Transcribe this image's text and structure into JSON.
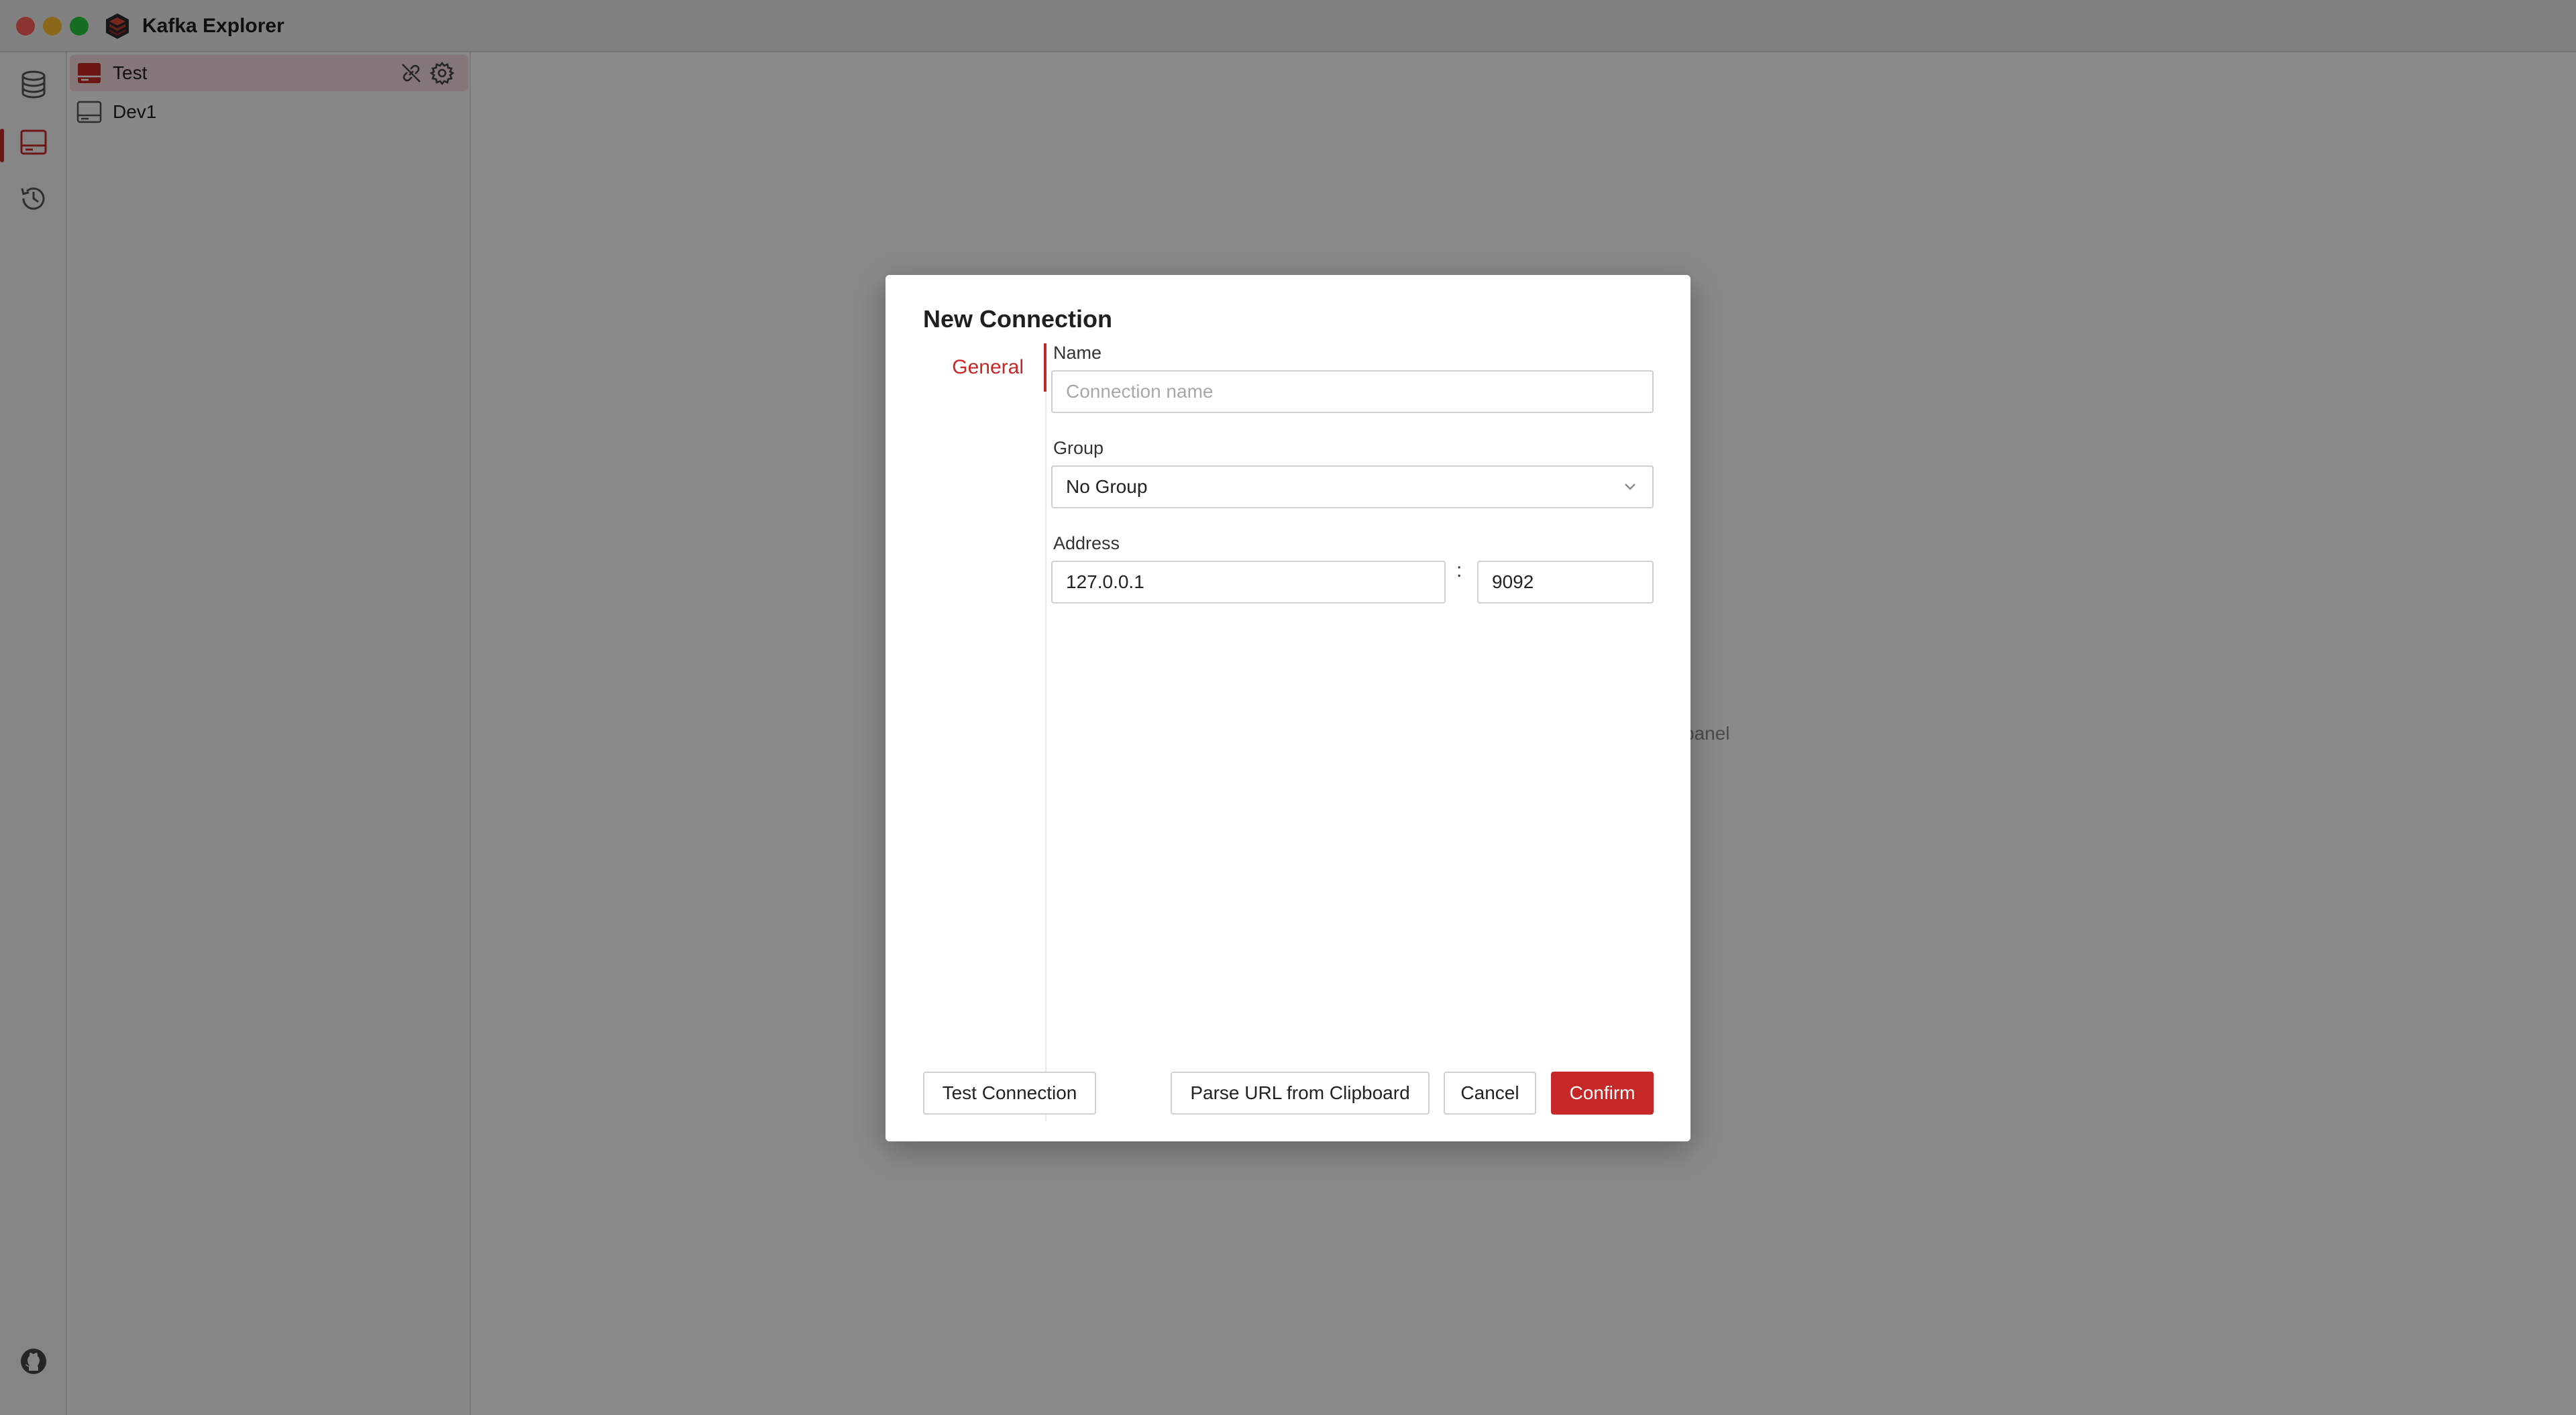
{
  "window": {
    "title": "Kafka Explorer"
  },
  "colors": {
    "accent": "#c62828",
    "selected_bg": "#f3d9d9"
  },
  "activity_bar": {
    "items": [
      {
        "icon": "database-icon",
        "active": false
      },
      {
        "icon": "connection-icon",
        "active": true
      },
      {
        "icon": "history-icon",
        "active": false
      }
    ],
    "footer_icon": "github-icon"
  },
  "sidebar": {
    "connections": [
      {
        "label": "Test",
        "selected": true
      },
      {
        "label": "Dev1",
        "selected": false
      }
    ]
  },
  "main": {
    "empty_hint_suffix": "panel"
  },
  "dialog": {
    "title": "New Connection",
    "tabs": [
      {
        "label": "General",
        "active": true
      }
    ],
    "name": {
      "label": "Name",
      "value": "",
      "placeholder": "Connection name"
    },
    "group": {
      "label": "Group",
      "value": "No Group"
    },
    "address": {
      "label": "Address",
      "host": "127.0.0.1",
      "separator": ":",
      "port": "9092"
    },
    "buttons": {
      "test": "Test Connection",
      "parse": "Parse URL from Clipboard",
      "cancel": "Cancel",
      "confirm": "Confirm"
    }
  }
}
